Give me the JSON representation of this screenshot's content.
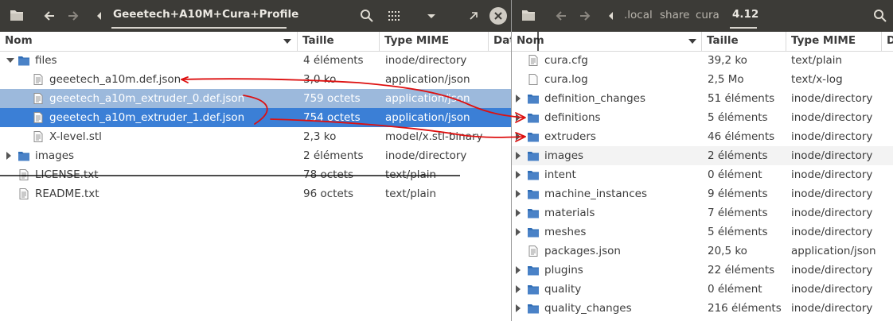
{
  "left_window": {
    "breadcrumb": {
      "current": "Geeetech+A10M+Cura+Profile"
    },
    "columns": {
      "name": "Nom",
      "size": "Taille",
      "type": "Type MIME",
      "date": "Date"
    },
    "rows": [
      {
        "name": "files",
        "size": "4 éléments",
        "type": "inode/directory",
        "kind": "folder",
        "expander": "down",
        "level": 0,
        "state": ""
      },
      {
        "name": "geeetech_a10m.def.json",
        "size": "3,0 ko",
        "type": "application/json",
        "kind": "file",
        "expander": "",
        "level": 1,
        "state": ""
      },
      {
        "name": "geeetech_a10m_extruder_0.def.json",
        "size": "759 octets",
        "type": "application/json",
        "kind": "file",
        "expander": "",
        "level": 1,
        "state": "selected-secondary"
      },
      {
        "name": "geeetech_a10m_extruder_1.def.json",
        "size": "754 octets",
        "type": "application/json",
        "kind": "file",
        "expander": "",
        "level": 1,
        "state": "selected"
      },
      {
        "name": "X-level.stl",
        "size": "2,3 ko",
        "type": "model/x.stl-binary",
        "kind": "file",
        "expander": "",
        "level": 1,
        "state": ""
      },
      {
        "name": "images",
        "size": "2 éléments",
        "type": "inode/directory",
        "kind": "folder",
        "expander": "right",
        "level": 0,
        "state": ""
      },
      {
        "name": "LICENSE.txt",
        "size": "78 octets",
        "type": "text/plain",
        "kind": "file",
        "expander": "",
        "level": 0,
        "state": ""
      },
      {
        "name": "README.txt",
        "size": "96 octets",
        "type": "text/plain",
        "kind": "file",
        "expander": "",
        "level": 0,
        "state": ""
      }
    ]
  },
  "right_window": {
    "breadcrumb": {
      "parts": [
        ".local",
        "share",
        "cura"
      ],
      "current": "4.12"
    },
    "columns": {
      "name": "Nom",
      "size": "Taille",
      "type": "Type MIME",
      "date": "Date"
    },
    "rows": [
      {
        "name": "cura.cfg",
        "size": "39,2 ko",
        "type": "text/plain",
        "kind": "file",
        "expander": "",
        "state": ""
      },
      {
        "name": "cura.log",
        "size": "2,5 Mo",
        "type": "text/x-log",
        "kind": "blank",
        "expander": "",
        "state": ""
      },
      {
        "name": "definition_changes",
        "size": "51 éléments",
        "type": "inode/directory",
        "kind": "folder",
        "expander": "right",
        "state": ""
      },
      {
        "name": "definitions",
        "size": "5 éléments",
        "type": "inode/directory",
        "kind": "folder",
        "expander": "right",
        "state": ""
      },
      {
        "name": "extruders",
        "size": "46 éléments",
        "type": "inode/directory",
        "kind": "folder",
        "expander": "right",
        "state": ""
      },
      {
        "name": "images",
        "size": "2 éléments",
        "type": "inode/directory",
        "kind": "folder",
        "expander": "right",
        "state": "hover"
      },
      {
        "name": "intent",
        "size": "0 élément",
        "type": "inode/directory",
        "kind": "folder",
        "expander": "right",
        "state": ""
      },
      {
        "name": "machine_instances",
        "size": "9 éléments",
        "type": "inode/directory",
        "kind": "folder",
        "expander": "right",
        "state": ""
      },
      {
        "name": "materials",
        "size": "7 éléments",
        "type": "inode/directory",
        "kind": "folder",
        "expander": "right",
        "state": ""
      },
      {
        "name": "meshes",
        "size": "5 éléments",
        "type": "inode/directory",
        "kind": "folder",
        "expander": "right",
        "state": ""
      },
      {
        "name": "packages.json",
        "size": "20,5 ko",
        "type": "application/json",
        "kind": "file",
        "expander": "",
        "state": ""
      },
      {
        "name": "plugins",
        "size": "22 éléments",
        "type": "inode/directory",
        "kind": "folder",
        "expander": "right",
        "state": ""
      },
      {
        "name": "quality",
        "size": "0 élément",
        "type": "inode/directory",
        "kind": "folder",
        "expander": "right",
        "state": ""
      },
      {
        "name": "quality_changes",
        "size": "216 éléments",
        "type": "inode/directory",
        "kind": "folder",
        "expander": "right",
        "state": ""
      }
    ]
  },
  "icons": {
    "app": "folder-app-icon",
    "nav": [
      "back-arrow-icon",
      "forward-arrow-icon",
      "breadcrumb-left-icon"
    ],
    "toolbar": [
      "search-icon",
      "grid-view-icon",
      "view-options-icon",
      "minimize-icon",
      "close-icon"
    ]
  },
  "colors": {
    "titlebar": "#3c3b37",
    "selection": "#3b7fd6",
    "selection_secondary": "#9cb9dc",
    "folder": "#4a82c7",
    "annotation": "#dd1010"
  }
}
